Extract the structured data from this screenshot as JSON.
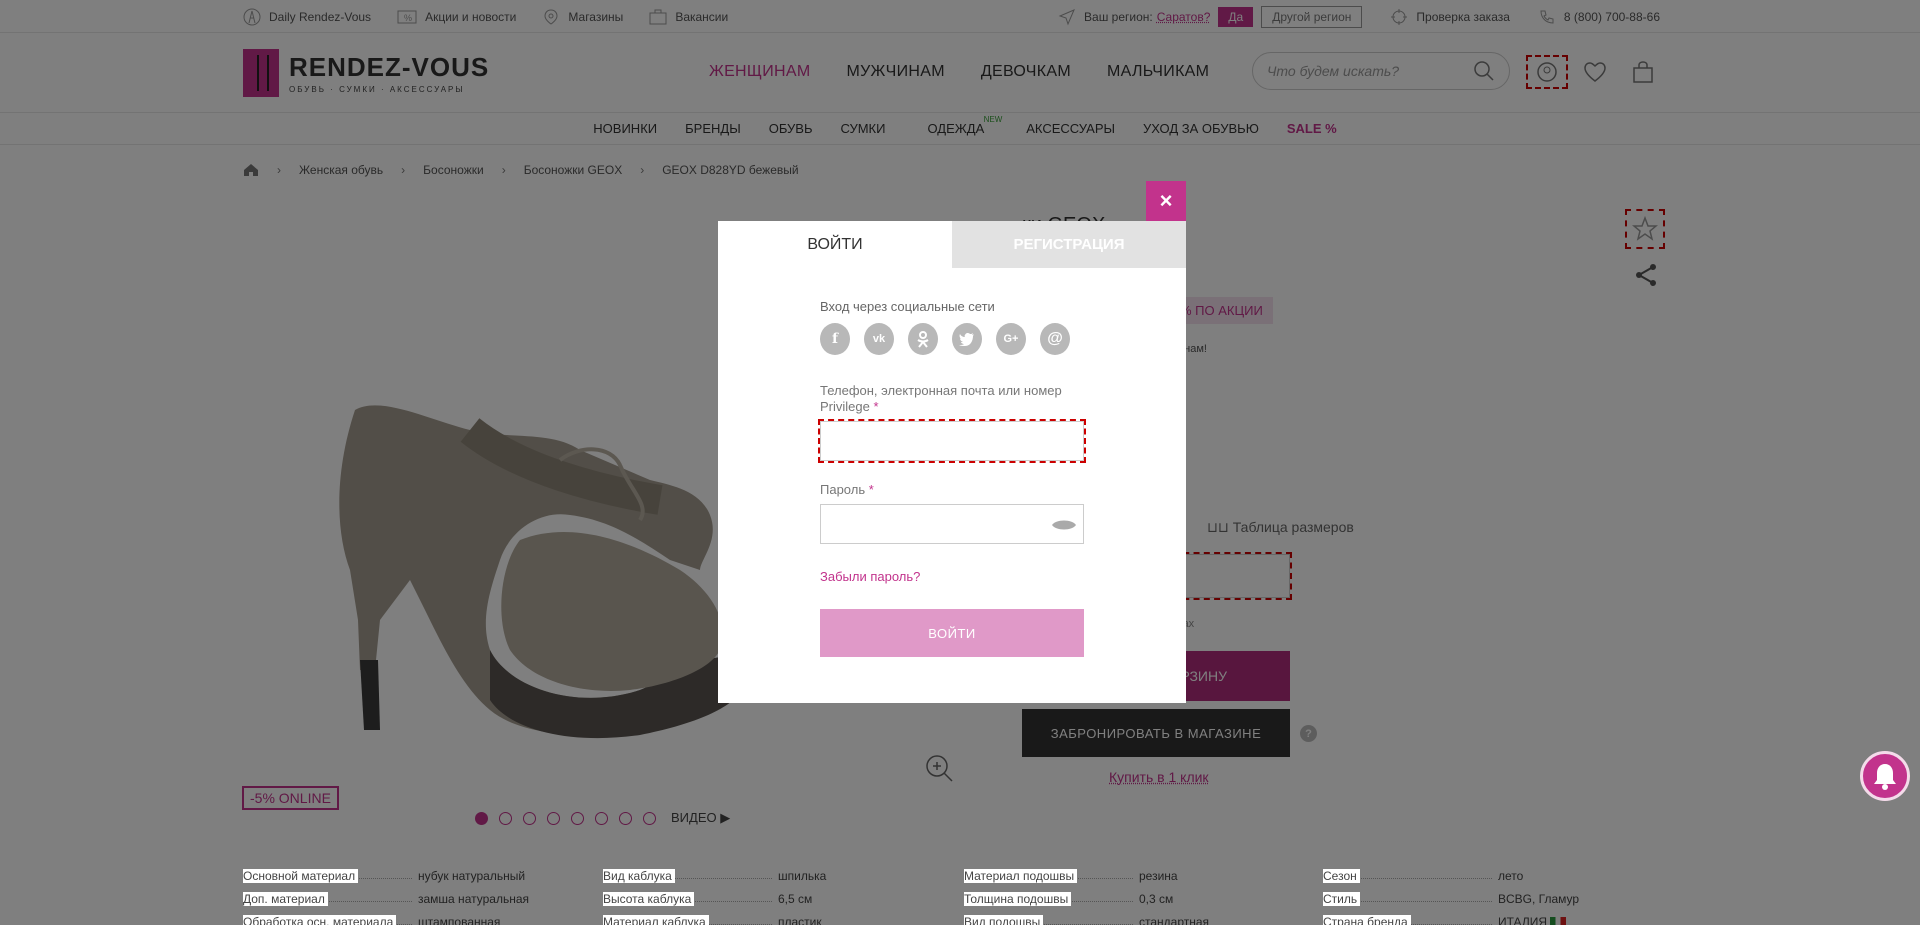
{
  "topbar": {
    "items": [
      {
        "label": "Daily Rendez-Vous",
        "icon": "eiffel-icon"
      },
      {
        "label": "Акции и новости",
        "icon": "percent-tag-icon"
      },
      {
        "label": "Магазины",
        "icon": "map-pin-icon"
      },
      {
        "label": "Вакансии",
        "icon": "briefcase-icon"
      }
    ],
    "region_prefix": "Ваш регион:",
    "region_value": "Саратов?",
    "yes_label": "Да",
    "other_region_label": "Другой регион",
    "order_check": "Проверка заказа",
    "phone": "8 (800) 700-88-66"
  },
  "header": {
    "logo_name": "RENDEZ-VOUS",
    "logo_sub": "ОБУВЬ · СУМКИ · АКСЕССУАРЫ",
    "nav": [
      "ЖЕНЩИНАМ",
      "МУЖЧИНАМ",
      "ДЕВОЧКАМ",
      "МАЛЬЧИКАМ"
    ],
    "search_placeholder": "Что будем искать?"
  },
  "subnav": {
    "items": [
      "НОВИНКИ",
      "БРЕНДЫ",
      "ОБУВЬ",
      "СУМКИ",
      "ОДЕЖДА",
      "АКСЕССУАРЫ",
      "УХОД ЗА ОБУВЬЮ"
    ],
    "new_badge": "NEW",
    "sale": "SALE %"
  },
  "breadcrumb": [
    "Женская обувь",
    "Босоножки",
    "Босоножки GEOX",
    "GEOX D828YD бежевый"
  ],
  "product": {
    "title_suffix": "ки",
    "brand": "GEOX",
    "promo_tag": "% ПО АКЦИИ",
    "promo_text": "е нам!",
    "size_table": "Таблица размеров",
    "size_note": "мах",
    "cart_label": "РЗИНУ",
    "reserve_label": "ЗАБРОНИРОВАТЬ В МАГАЗИНЕ",
    "help": "?",
    "buy_one": "Купить в 1 клик",
    "badge": "-5% ONLINE",
    "video": "ВИДЕО ▶",
    "slide_count": 8,
    "active_slide": 1
  },
  "specs": [
    [
      {
        "label": "Основной материал",
        "value": "нубук натуральный"
      },
      {
        "label": "Доп. материал",
        "value": "замша натуральная"
      },
      {
        "label": "Обработка осн. материала",
        "value": "штампованная"
      }
    ],
    [
      {
        "label": "Вид каблука",
        "value": "шпилька"
      },
      {
        "label": "Высота каблука",
        "value": "6,5 см"
      },
      {
        "label": "Материал каблука",
        "value": "пластик"
      }
    ],
    [
      {
        "label": "Материал подошвы",
        "value": "резина"
      },
      {
        "label": "Толщина подошвы",
        "value": "0,3 см"
      },
      {
        "label": "Вид подошвы",
        "value": "стандартная"
      }
    ],
    [
      {
        "label": "Сезон",
        "value": "лето"
      },
      {
        "label": "Стиль",
        "value": "BCBG, Гламур"
      },
      {
        "label": "Страна бренда",
        "value": "ИТАЛИЯ"
      }
    ]
  ],
  "modal": {
    "close": "×",
    "tab_login": "ВОЙТИ",
    "tab_register": "РЕГИСТРАЦИЯ",
    "social_label": "Вход через социальные сети",
    "socials": [
      "f",
      "vk",
      "ok",
      "tw",
      "G+",
      "@"
    ],
    "login_label": "Телефон, электронная почта или номер Privilege",
    "login_value": "",
    "password_label": "Пароль",
    "password_value": "",
    "required_mark": "*",
    "forgot": "Забыли пароль?",
    "submit": "ВОЙТИ"
  },
  "colors": {
    "accent": "#c2338c",
    "submit_disabled": "#e099c8",
    "dark_button": "#333333"
  }
}
